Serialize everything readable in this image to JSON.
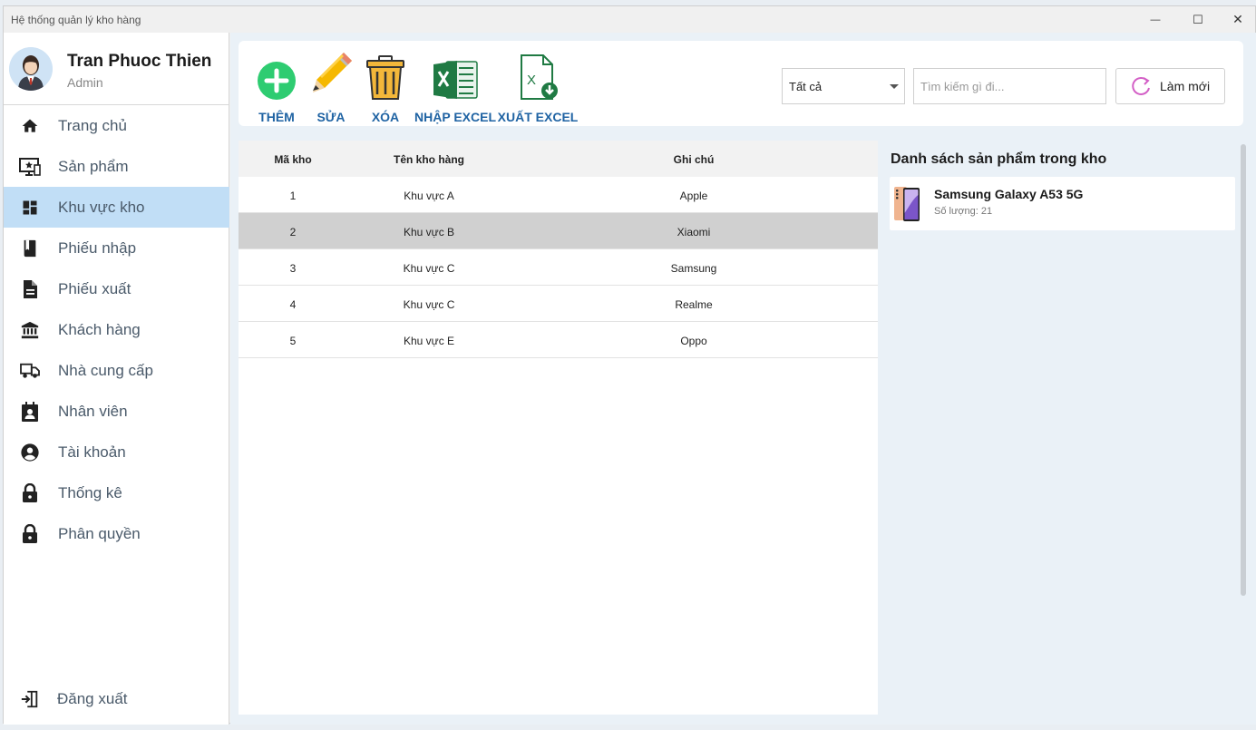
{
  "window": {
    "title": "Hệ thống quản lý kho hàng",
    "controls": {
      "minimize": "—",
      "maximize": "☐",
      "close": "✕"
    }
  },
  "profile": {
    "name": "Tran Phuoc Thien",
    "role": "Admin"
  },
  "sidebar": {
    "items": [
      {
        "label": "Trang chủ",
        "icon": "home-icon"
      },
      {
        "label": "Sản phẩm",
        "icon": "product-monitor-icon"
      },
      {
        "label": "Khu vực kho",
        "icon": "dashboard-icon",
        "active": true
      },
      {
        "label": "Phiếu nhập",
        "icon": "book-icon"
      },
      {
        "label": "Phiếu xuất",
        "icon": "document-icon"
      },
      {
        "label": "Khách hàng",
        "icon": "bank-icon"
      },
      {
        "label": "Nhà cung cấp",
        "icon": "truck-icon"
      },
      {
        "label": "Nhân viên",
        "icon": "contact-card-icon"
      },
      {
        "label": "Tài khoản",
        "icon": "account-circle-icon"
      },
      {
        "label": "Thống kê",
        "icon": "lock-icon"
      },
      {
        "label": "Phân quyền",
        "icon": "lock-icon"
      }
    ],
    "logout": {
      "label": "Đăng xuất",
      "icon": "logout-icon"
    }
  },
  "toolbar": {
    "add": "THÊM",
    "edit": "SỬA",
    "delete": "XÓA",
    "import_excel": "NHẬP EXCEL",
    "export_excel": "XUẤT EXCEL",
    "filter_value": "Tất cả",
    "search_placeholder": "Tìm kiếm gì đi...",
    "refresh": "Làm mới"
  },
  "table": {
    "columns": [
      "Mã kho",
      "Tên kho hàng",
      "Ghi chú"
    ],
    "rows": [
      {
        "id": "1",
        "name": "Khu vực A",
        "note": "Apple"
      },
      {
        "id": "2",
        "name": "Khu vực B",
        "note": "Xiaomi",
        "selected": true
      },
      {
        "id": "3",
        "name": "Khu vực C",
        "note": "Samsung"
      },
      {
        "id": "4",
        "name": "Khu vực C",
        "note": "Realme"
      },
      {
        "id": "5",
        "name": "Khu vực E",
        "note": "Oppo"
      }
    ]
  },
  "product_panel": {
    "title": "Danh sách sản phẩm trong kho",
    "items": [
      {
        "name": "Samsung Galaxy A53 5G",
        "quantity": "Số lượng: 21"
      }
    ]
  },
  "colors": {
    "accent_blue": "#1f63a3",
    "active_nav": "#c1def6",
    "add_green": "#2ecc71",
    "excel_green": "#1f7a43",
    "selected_row": "#d0d0d0"
  }
}
